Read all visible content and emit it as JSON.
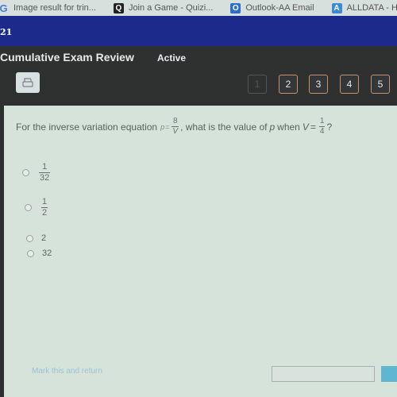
{
  "bookmarks": [
    {
      "icon": "google-icon",
      "glyph": "G",
      "label": "Image result for trin..."
    },
    {
      "icon": "quizizz-icon",
      "glyph": "Q",
      "label": "Join a Game - Quizi..."
    },
    {
      "icon": "outlook-icon",
      "glyph": "O",
      "label": "Outlook-AA Email"
    },
    {
      "icon": "alldata-icon",
      "glyph": "A",
      "label": "ALLDATA - Ho"
    }
  ],
  "topbar": {
    "number": "21"
  },
  "header": {
    "title": "Cumulative Exam Review",
    "status": "Active",
    "print_icon": "printer-icon"
  },
  "question_nav": {
    "current": 1,
    "items": [
      "1",
      "2",
      "3",
      "4",
      "5"
    ]
  },
  "question": {
    "prefix": "For the inverse variation equation",
    "eq_var": "p",
    "eq_sign": "=",
    "eq_num": "8",
    "eq_den": "V",
    "mid": ", what is the value of",
    "var_p": "p",
    "when": "when",
    "var_v": "V",
    "v_sign": "=",
    "v_num": "1",
    "v_den": "4",
    "suffix": "?"
  },
  "options": [
    {
      "type": "fraction",
      "num": "1",
      "den": "32"
    },
    {
      "type": "fraction",
      "num": "1",
      "den": "2"
    },
    {
      "type": "text",
      "value": "2"
    },
    {
      "type": "text",
      "value": "32"
    }
  ],
  "footer": {
    "mark_link": "Mark this and return"
  }
}
